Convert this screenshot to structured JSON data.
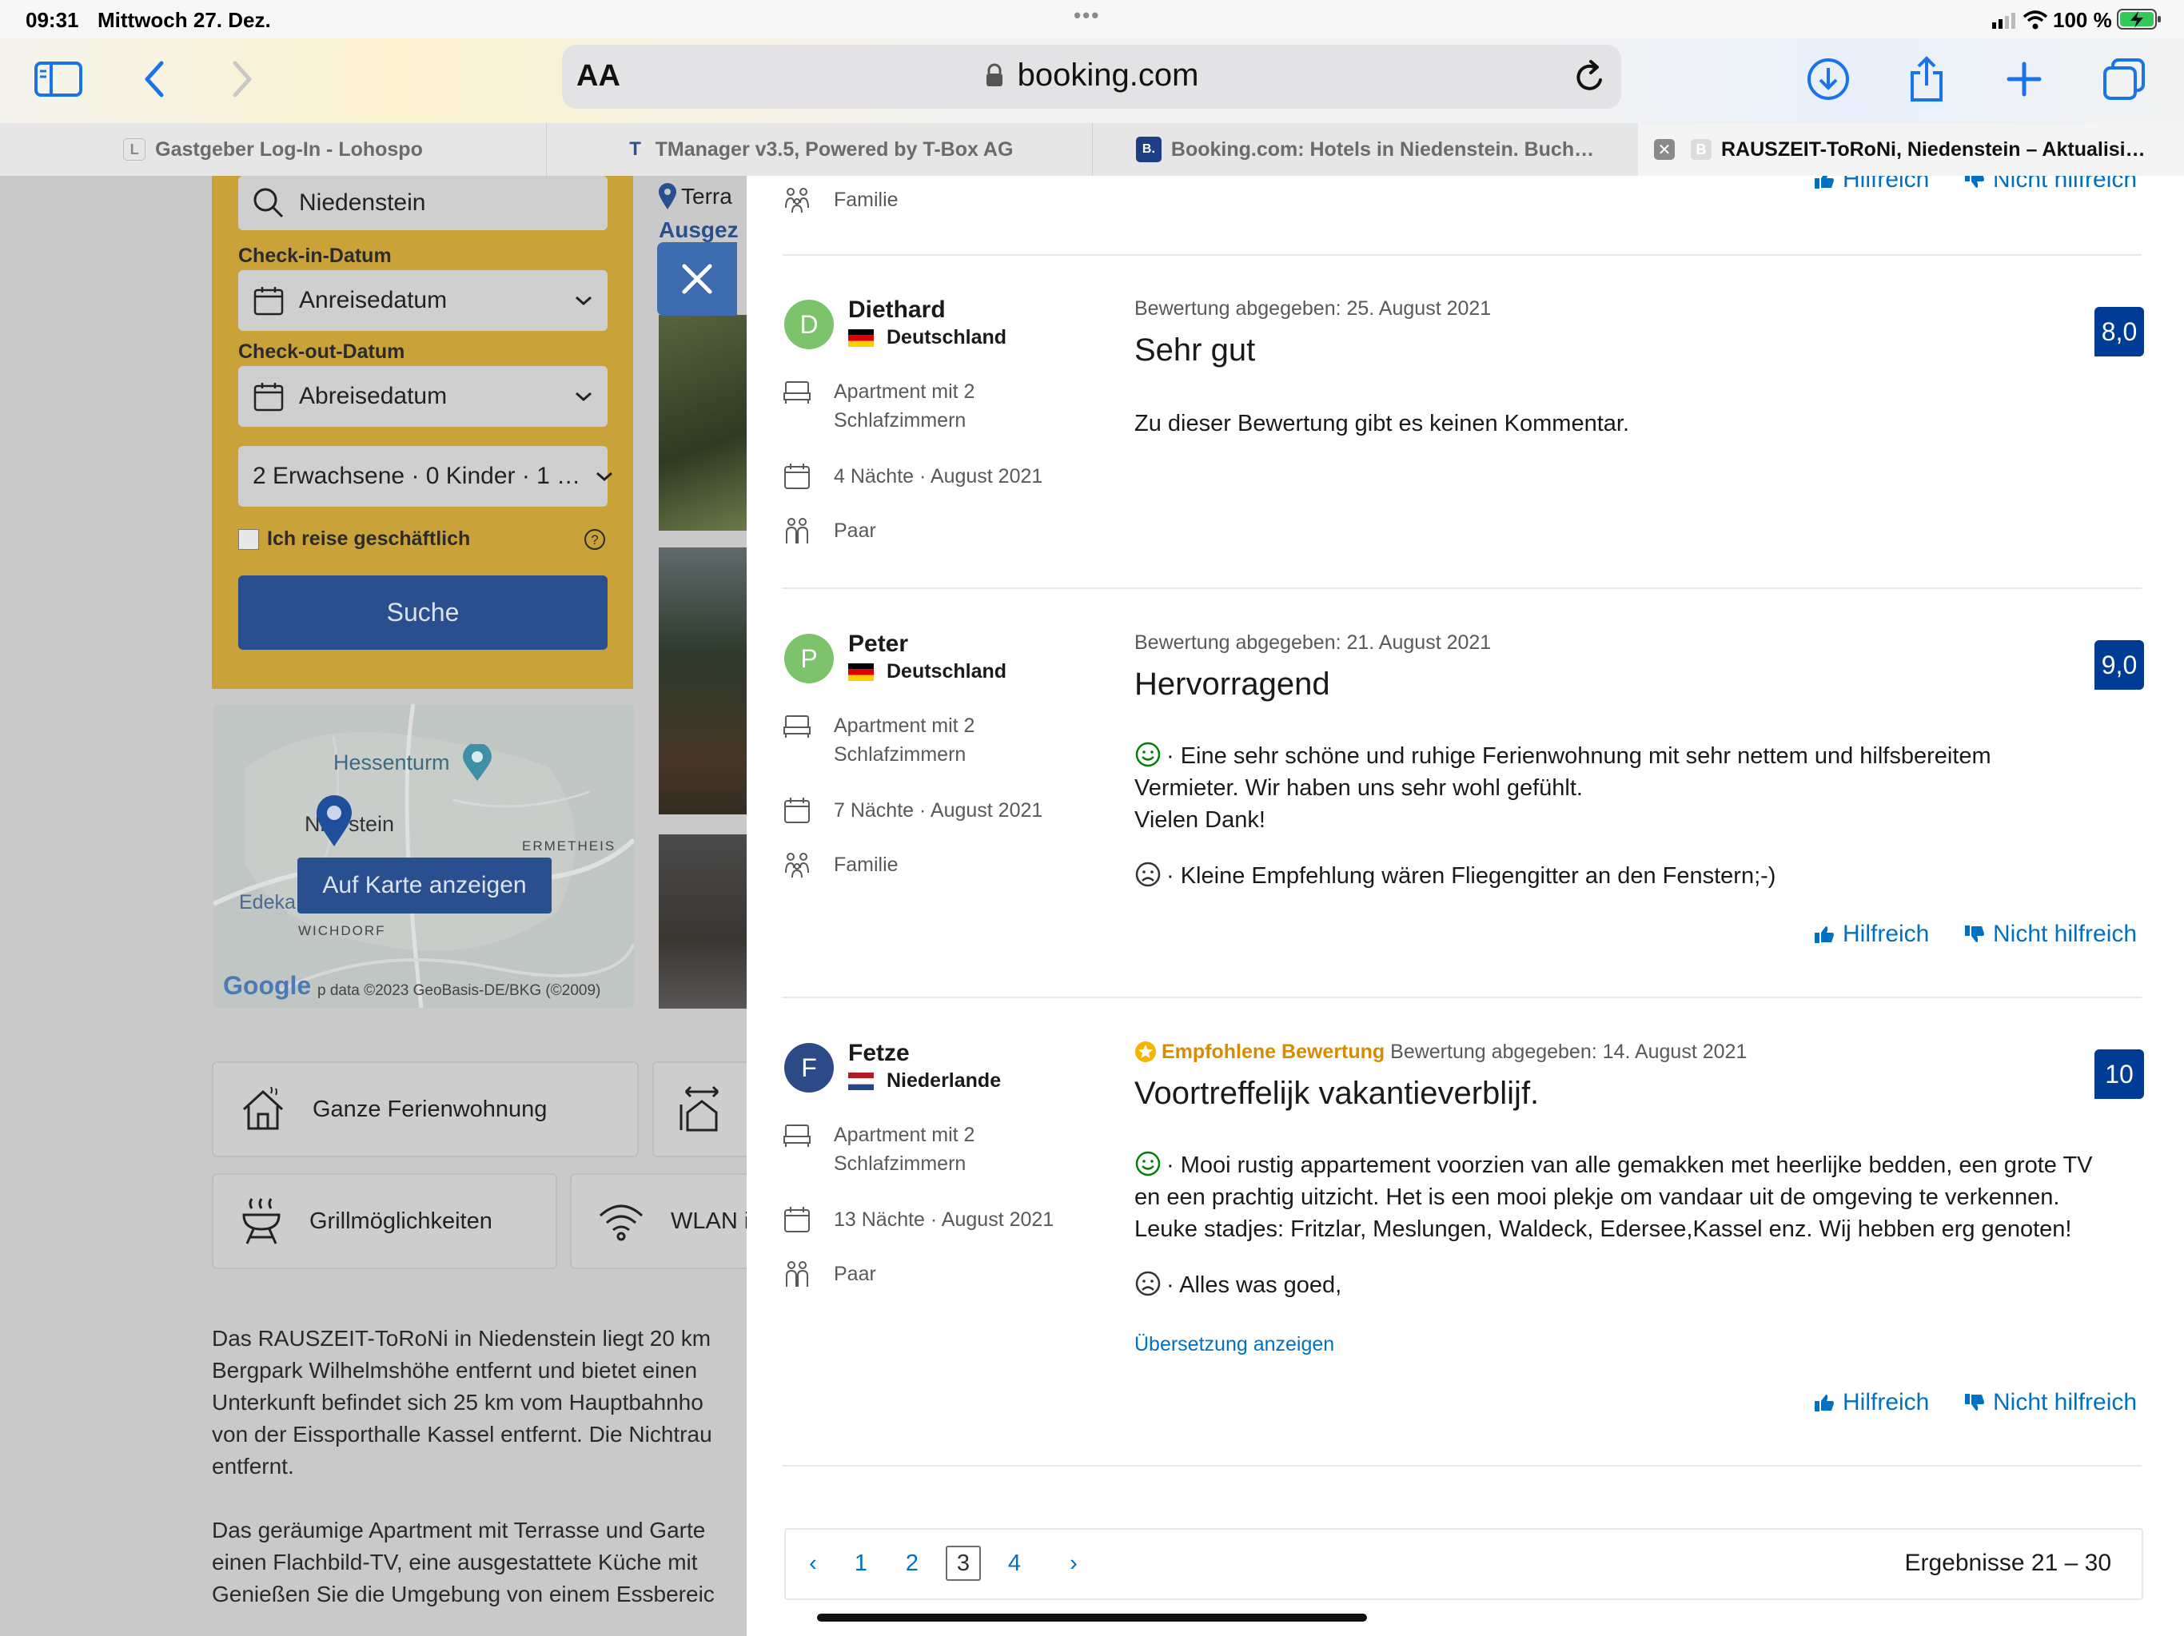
{
  "status_bar": {
    "time": "09:31",
    "date": "Mittwoch 27. Dez.",
    "dots": "•••",
    "battery": "100 %"
  },
  "toolbar": {
    "text_size_label": "AA",
    "domain": "booking.com",
    "icons": [
      "sidebar-icon",
      "back-icon",
      "forward-icon",
      "lock-icon",
      "reload-icon",
      "download-icon",
      "share-icon",
      "plus-icon",
      "tabs-icon"
    ]
  },
  "tabs": [
    {
      "label": "Gastgeber Log-In - Lohospo",
      "favicon": "L"
    },
    {
      "label": "TManager v3.5, Powered by T-Box AG",
      "favicon": "T"
    },
    {
      "label": "Booking.com: Hotels in Niedenstein. Buch…",
      "favicon": "B."
    },
    {
      "label": "RAUSZEIT-ToRoNi, Niedenstein – Aktualisi…",
      "favicon": "B"
    }
  ],
  "search": {
    "destination": "Niedenstein",
    "checkin_label": "Check-in-Datum",
    "checkin_value": "Anreisedatum",
    "checkout_label": "Check-out-Datum",
    "checkout_value": "Abreisedatum",
    "guests": "2 Erwachsene · 0 Kinder · 1 …",
    "business_label": "Ich reise geschäftlich",
    "button": "Suche"
  },
  "map": {
    "place1": "Hessenturm",
    "place2_a": "Nie",
    "place2_b": "stein",
    "place3": "ERMETHEIS",
    "place4": "Edeka",
    "place5": "WICHDORF",
    "button": "Auf Karte anzeigen",
    "google": "Google",
    "attribution": "p data ©2023 GeoBasis-DE/BKG (©2009)"
  },
  "behind": {
    "location_label": "Terra",
    "location_sub": "Ausgez",
    "features": [
      "Ganze Ferienwohnung",
      "Grillmöglichkeiten",
      "WLAN i"
    ],
    "description": [
      "Das RAUSZEIT-ToRoNi in Niedenstein liegt 20 km",
      "Bergpark Wilhelmshöhe entfernt und bietet einen",
      "Unterkunft befindet sich 25 km vom Hauptbahnho",
      "von der Eissporthalle Kassel entfernt. Die Nichtrau",
      "entfernt.",
      "",
      "Das geräumige Apartment mit Terrasse und Garte",
      "einen Flachbild-TV, eine ausgestattete Küche mit",
      "Genießen Sie die Umgebung von einem Essbereic"
    ]
  },
  "reviews_panel": {
    "top_partial": {
      "meta_group": "Familie",
      "helpful": "Hilfreich",
      "not_helpful": "Nicht hilfreich"
    },
    "reviews": [
      {
        "initial": "D",
        "name": "Diethard",
        "country": "Deutschland",
        "room": [
          "Apartment mit 2",
          "Schlafzimmern"
        ],
        "stay": "4 Nächte · August 2021",
        "group": "Paar",
        "date": "Bewertung abgegeben: 25. August 2021",
        "title": "Sehr gut",
        "score": "8,0",
        "text": [
          "Zu dieser Bewertung gibt es keinen Kommentar."
        ]
      },
      {
        "initial": "P",
        "name": "Peter",
        "country": "Deutschland",
        "room": [
          "Apartment mit 2",
          "Schlafzimmern"
        ],
        "stay": "7 Nächte · August 2021",
        "group": "Familie",
        "date": "Bewertung abgegeben: 21. August 2021",
        "title": "Hervorragend",
        "score": "9,0",
        "positive": [
          "· Eine sehr schöne und ruhige Ferienwohnung mit sehr nettem und hilfsbereitem",
          "Vermieter. Wir haben uns sehr wohl gefühlt.",
          "Vielen Dank!"
        ],
        "negative": "· Kleine Empfehlung wären Fliegengitter an den Fenstern;-)",
        "helpful": "Hilfreich",
        "not_helpful": "Nicht hilfreich"
      },
      {
        "initial": "F",
        "name": "Fetze",
        "country": "Niederlande",
        "room": [
          "Apartment mit 2",
          "Schlafzimmern"
        ],
        "stay": "13 Nächte · August 2021",
        "group": "Paar",
        "recommended": "Empfohlene Bewertung",
        "date": "Bewertung abgegeben: 14. August 2021",
        "title": "Voortreffelijk vakantieverblijf.",
        "score": "10",
        "positive": [
          "· Mooi rustig appartement voorzien van alle gemakken met heerlijke bedden, een grote TV",
          "en een prachtig uitzicht. Het is een mooi plekje om vandaar uit de omgeving te verkennen.",
          "Leuke stadjes: Fritzlar, Meslungen, Waldeck, Edersee,Kassel enz. Wij hebben erg genoten!"
        ],
        "negative": "· Alles was goed,",
        "translate": "Übersetzung anzeigen",
        "helpful": "Hilfreich",
        "not_helpful": "Nicht hilfreich"
      }
    ],
    "pagination": {
      "pages": [
        "1",
        "2",
        "3",
        "4"
      ],
      "current": "3",
      "prev": "‹",
      "next": "›",
      "results": "Ergebnisse 21 – 30"
    }
  },
  "colors": {
    "brand_blue": "#003b95",
    "link_blue": "#0071c2",
    "recommended": "#d98b00",
    "avatar_green": "#7cc36c",
    "avatar_navy": "#2b4a87"
  }
}
